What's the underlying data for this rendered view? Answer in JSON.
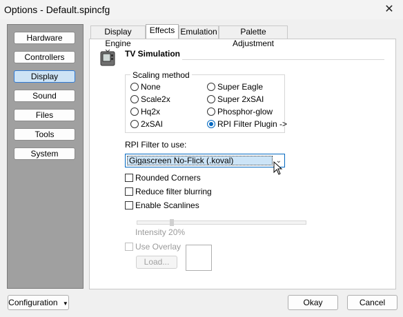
{
  "window": {
    "title": "Options - Default.spincfg",
    "close_glyph": "✕"
  },
  "sidebar": {
    "items": [
      {
        "label": "Hardware"
      },
      {
        "label": "Controllers"
      },
      {
        "label": "Display",
        "active": true
      },
      {
        "label": "Sound"
      },
      {
        "label": "Files"
      },
      {
        "label": "Tools"
      },
      {
        "label": "System"
      }
    ]
  },
  "tabs": [
    {
      "label": "Display Engine"
    },
    {
      "label": "Effects",
      "active": true
    },
    {
      "label": "Emulation"
    },
    {
      "label": "Palette Adjustment"
    }
  ],
  "effects": {
    "section_title": "TV Simulation",
    "icon": "tv-icon",
    "scaling": {
      "label": "Scaling method",
      "options": [
        {
          "label": "None"
        },
        {
          "label": "Super Eagle"
        },
        {
          "label": "Scale2x"
        },
        {
          "label": "Super 2xSAI"
        },
        {
          "label": "Hq2x"
        },
        {
          "label": "Phosphor-glow"
        },
        {
          "label": "2xSAI"
        },
        {
          "label": "RPI Filter Plugin ->",
          "selected": true
        }
      ]
    },
    "rpi_filter": {
      "label": "RPI Filter to use:",
      "value": "Gigascreen No-Flick (.koval)"
    },
    "checkboxes": {
      "rounded_corners": {
        "label": "Rounded Corners",
        "checked": false
      },
      "reduce_blurring": {
        "label": "Reduce filter blurring",
        "checked": false
      },
      "scanlines": {
        "label": "Enable Scanlines",
        "checked": false
      }
    },
    "intensity": {
      "label": "Intensity 20%",
      "value": 20
    },
    "overlay": {
      "label": "Use Overlay",
      "checked": false,
      "load_label": "Load..."
    }
  },
  "footer": {
    "configuration_label": "Configuration",
    "ok_label": "Okay",
    "cancel_label": "Cancel"
  },
  "colors": {
    "accent": "#0067c0",
    "sidebar_bg": "#a0a0a0",
    "active_nav": "#cde3f5"
  }
}
